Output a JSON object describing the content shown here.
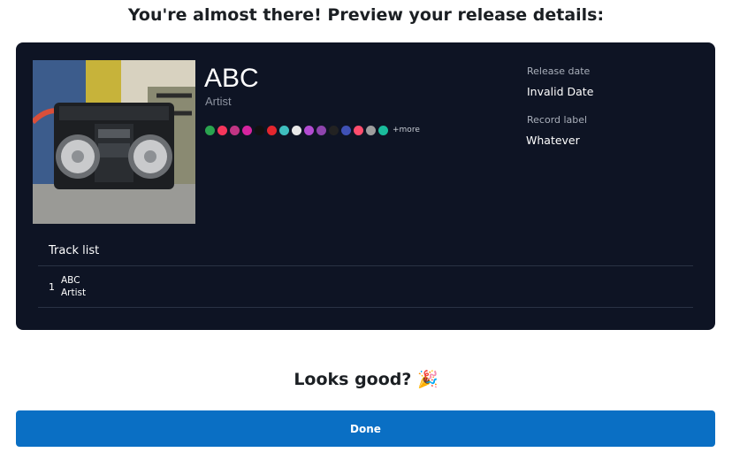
{
  "header": {
    "title": "You're almost there! Preview your release details:"
  },
  "release": {
    "title": "ABC",
    "artist": "Artist",
    "more_label": "+more",
    "release_date_label": "Release date",
    "release_date_value": "Invalid Date",
    "record_label_label": "Record label",
    "record_label_value": "Whatever",
    "platform_icons": [
      {
        "name": "platform-icon-1",
        "color": "#2aa44f"
      },
      {
        "name": "platform-icon-2",
        "color": "#f5365c"
      },
      {
        "name": "platform-icon-3",
        "color": "#c13584"
      },
      {
        "name": "platform-icon-4",
        "color": "#d6249f"
      },
      {
        "name": "platform-icon-5",
        "color": "#111111"
      },
      {
        "name": "platform-icon-6",
        "color": "#e3262e"
      },
      {
        "name": "platform-icon-7",
        "color": "#3fbfbf"
      },
      {
        "name": "platform-icon-8",
        "color": "#e8e8e8"
      },
      {
        "name": "platform-icon-9",
        "color": "#b24bd1"
      },
      {
        "name": "platform-icon-10",
        "color": "#8e44ad"
      },
      {
        "name": "platform-icon-11",
        "color": "#222222"
      },
      {
        "name": "platform-icon-12",
        "color": "#3f51b5"
      },
      {
        "name": "platform-icon-13",
        "color": "#ff4d6d"
      },
      {
        "name": "platform-icon-14",
        "color": "#9e9e9e"
      },
      {
        "name": "platform-icon-15",
        "color": "#1abc9c"
      }
    ]
  },
  "tracklist": {
    "heading": "Track list",
    "tracks": [
      {
        "number": "1",
        "title": "ABC",
        "artist": "Artist"
      }
    ]
  },
  "footer": {
    "question": "Looks good? 🎉",
    "done_label": "Done"
  }
}
